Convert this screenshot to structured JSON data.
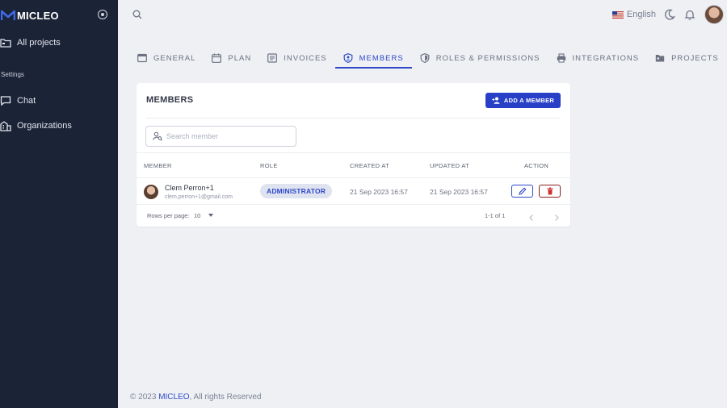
{
  "app": {
    "brand_name": "MICLEO"
  },
  "sidebar": {
    "items": [
      {
        "label": "All projects",
        "icon": "folder-icon"
      },
      {
        "label": "Chat",
        "icon": "chat-icon"
      },
      {
        "label": "Organizations",
        "icon": "building-icon"
      }
    ],
    "section_label": "Settings"
  },
  "topbar": {
    "language": "English",
    "flag": "us-flag-icon"
  },
  "tabs": [
    {
      "label": "GENERAL",
      "icon": "card-icon",
      "active": false
    },
    {
      "label": "PLAN",
      "icon": "calendar-icon",
      "active": false
    },
    {
      "label": "INVOICES",
      "icon": "invoice-icon",
      "active": false
    },
    {
      "label": "MEMBERS",
      "icon": "user-shield-icon",
      "active": true
    },
    {
      "label": "ROLES & PERMISSIONS",
      "icon": "shield-icon",
      "active": false
    },
    {
      "label": "INTEGRATIONS",
      "icon": "printer-icon",
      "active": false
    },
    {
      "label": "PROJECTS",
      "icon": "folder-icon",
      "active": false
    }
  ],
  "members_card": {
    "title": "MEMBERS",
    "add_button_label": "ADD A MEMBER",
    "search_placeholder": "Search member",
    "columns": [
      "MEMBER",
      "ROLE",
      "CREATED AT",
      "UPDATED AT",
      "ACTION"
    ],
    "rows": [
      {
        "name": "Clem Perron+1",
        "email": "clem.perron+1@gmail.com",
        "role": "ADMINISTRATOR",
        "created_at": "21 Sep 2023 16:57",
        "updated_at": "21 Sep 2023 16:57"
      }
    ],
    "rows_per_page_label": "Rows per page:",
    "rows_per_page_value": "10",
    "range_label": "1-1 of 1"
  },
  "footer": {
    "prefix": "© 2023",
    "brand": "MICLEO",
    "suffix": ", All rights Reserved"
  },
  "colors": {
    "sidebar_bg": "#1b2336",
    "accent": "#2f49c8",
    "danger": "#d32f2f"
  }
}
